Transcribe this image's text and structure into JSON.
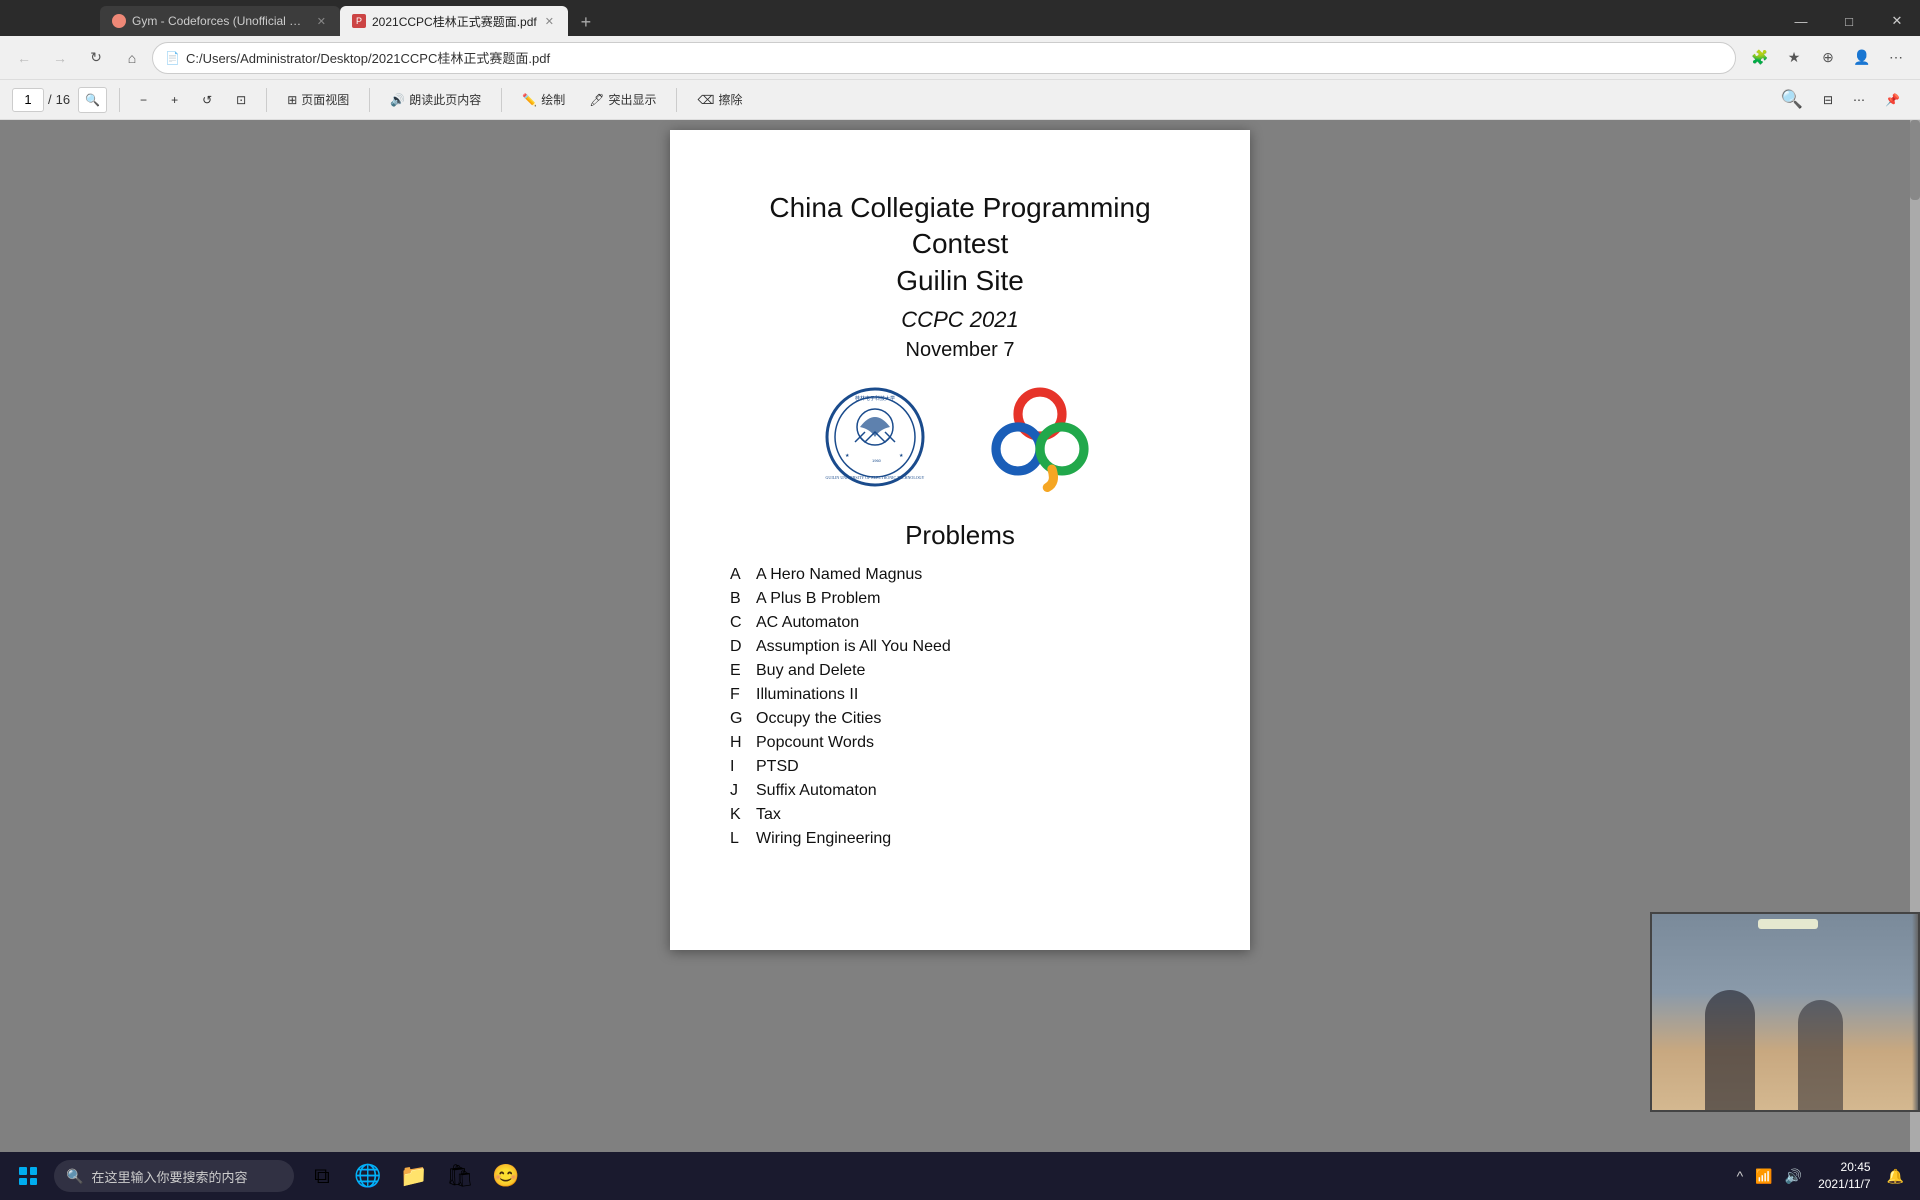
{
  "browser": {
    "tabs": [
      {
        "id": "tab-gym",
        "label": "Gym - Codeforces (Unofficial m...",
        "favicon": "gym",
        "active": false
      },
      {
        "id": "tab-pdf",
        "label": "2021CCPC桂林正式赛题面.pdf",
        "favicon": "pdf",
        "active": true
      }
    ],
    "new_tab_label": "+",
    "win_controls": {
      "minimize": "—",
      "maximize": "□",
      "close": "✕"
    }
  },
  "toolbar": {
    "back": "←",
    "forward": "→",
    "refresh": "↻",
    "home": "⌂",
    "address": "C:/Users/Administrator/Desktop/2021CCPC桂林正式赛题面.pdf",
    "address_icon": "📄"
  },
  "pdf_toolbar": {
    "page_current": "1",
    "page_total": "16",
    "zoom_out": "−",
    "zoom_in": "+",
    "rotate_left": "↺",
    "fit_page": "⊡",
    "view_mode": "页面视图",
    "read_aloud": "朗读此页内容",
    "draw": "绘制",
    "highlight": "突出显示",
    "erase": "擦除",
    "search_label": "🔍"
  },
  "pdf_content": {
    "title_line1": "China Collegiate Programming Contest",
    "title_line2": "Guilin Site",
    "subtitle": "CCPC 2021",
    "date": "November 7",
    "problems_heading": "Problems",
    "problems": [
      {
        "letter": "A",
        "name": "A Hero Named Magnus"
      },
      {
        "letter": "B",
        "name": "A Plus B Problem"
      },
      {
        "letter": "C",
        "name": "AC Automaton"
      },
      {
        "letter": "D",
        "name": "Assumption is All You Need"
      },
      {
        "letter": "E",
        "name": "Buy and Delete"
      },
      {
        "letter": "F",
        "name": "Illuminations II"
      },
      {
        "letter": "G",
        "name": "Occupy the Cities"
      },
      {
        "letter": "H",
        "name": "Popcount Words"
      },
      {
        "letter": "I",
        "name": "PTSD"
      },
      {
        "letter": "J",
        "name": "Suffix Automaton"
      },
      {
        "letter": "K",
        "name": "Tax"
      },
      {
        "letter": "L",
        "name": "Wiring Engineering"
      }
    ]
  },
  "taskbar": {
    "search_placeholder": "在这里输入你要搜索的内容",
    "clock_time": "20:xx",
    "apps": [
      "⊞",
      "🔍",
      "💬",
      "🌐",
      "📁",
      "🛒",
      "😊"
    ]
  }
}
